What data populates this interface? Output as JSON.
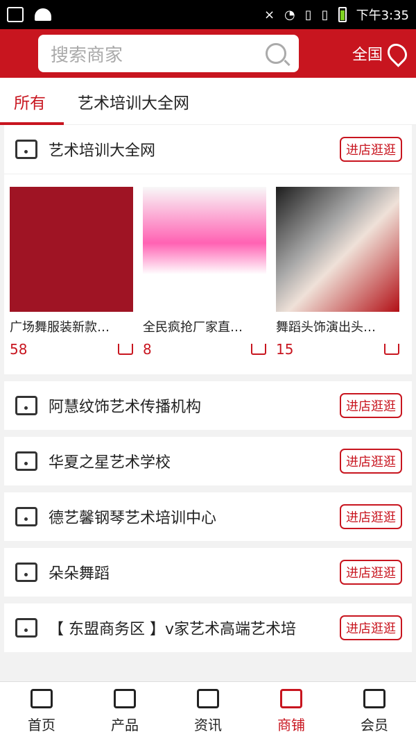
{
  "status": {
    "time": "下午3:35"
  },
  "header": {
    "search_placeholder": "搜索商家",
    "region": "全国"
  },
  "tabs": [
    {
      "label": "所有"
    },
    {
      "label": "艺术培训大全网"
    }
  ],
  "first_shop": {
    "name": "艺术培训大全网",
    "button": "进店逛逛"
  },
  "products": [
    {
      "name": "广场舞服装新款…",
      "price": "58",
      "image_color": "#9f1424"
    },
    {
      "name": "全民疯抢厂家直…",
      "price": "8",
      "image_color": "#ff62b3"
    },
    {
      "name": "舞蹈头饰演出头…",
      "price": "15",
      "image_color": "#d9d0d7"
    }
  ],
  "shops": [
    {
      "name": "阿慧纹饰艺术传播机构",
      "button": "进店逛逛"
    },
    {
      "name": "华夏之星艺术学校",
      "button": "进店逛逛"
    },
    {
      "name": "德艺馨钢琴艺术培训中心",
      "button": "进店逛逛"
    },
    {
      "name": "朵朵舞蹈",
      "button": "进店逛逛"
    },
    {
      "name": "【 东盟商务区 】v家艺术高端艺术培",
      "button": "进店逛逛"
    }
  ],
  "nav": [
    {
      "label": "首页"
    },
    {
      "label": "产品"
    },
    {
      "label": "资讯"
    },
    {
      "label": "商铺"
    },
    {
      "label": "会员"
    }
  ],
  "colors": {
    "accent": "#c8151f"
  }
}
